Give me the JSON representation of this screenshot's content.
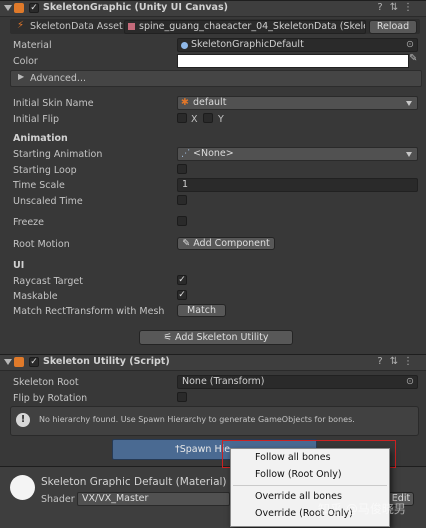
{
  "skeleton_graphic": {
    "title": "SkeletonGraphic (Unity UI Canvas)",
    "skeleton_data_label": "SkeletonData Asset",
    "skeleton_data_value": "spine_guang_chaeacter_04_SkeletonData (Skelet",
    "reload_label": "Reload",
    "material_label": "Material",
    "material_value": "SkeletonGraphicDefault",
    "color_label": "Color",
    "advanced_label": "Advanced...",
    "initial_skin_label": "Initial Skin Name",
    "initial_skin_value": "default",
    "initial_flip_label": "Initial Flip",
    "flip_x": "X",
    "flip_y": "Y",
    "animation_section": "Animation",
    "starting_animation_label": "Starting Animation",
    "starting_animation_value": "<None>",
    "starting_loop_label": "Starting Loop",
    "time_scale_label": "Time Scale",
    "time_scale_value": "1",
    "unscaled_time_label": "Unscaled Time",
    "freeze_label": "Freeze",
    "root_motion_label": "Root Motion",
    "add_component_label": "Add Component",
    "ui_section": "UI",
    "raycast_target_label": "Raycast Target",
    "maskable_label": "Maskable",
    "match_rect_label": "Match RectTransform with Mesh",
    "match_button_label": "Match",
    "add_skeleton_utility_label": "Add Skeleton Utility"
  },
  "skeleton_utility": {
    "title": "Skeleton Utility (Script)",
    "skeleton_root_label": "Skeleton Root",
    "skeleton_root_value": "None (Transform)",
    "flip_by_rotation_label": "Flip by Rotation",
    "info_message": "No hierarchy found. Use Spawn Hierarchy to generate GameObjects for bones.",
    "spawn_button_label": "†Spawn Hie"
  },
  "material_panel": {
    "title": "Skeleton Graphic Default (Material)",
    "shader_label": "Shader",
    "shader_value": "VX/VX_Master",
    "edit_label": "Edit"
  },
  "popup_menu": {
    "items": [
      "Follow all bones",
      "Follow (Root Only)",
      "Override all bones",
      "Override (Root Only)"
    ]
  },
  "watermark": "知乎 @马俊晓男",
  "colors": {
    "background": "#383838",
    "header": "#3e3e3e",
    "field": "#2a2a2a",
    "highlight_box": "#cc2222",
    "spawn_button": "#4a6a92"
  }
}
